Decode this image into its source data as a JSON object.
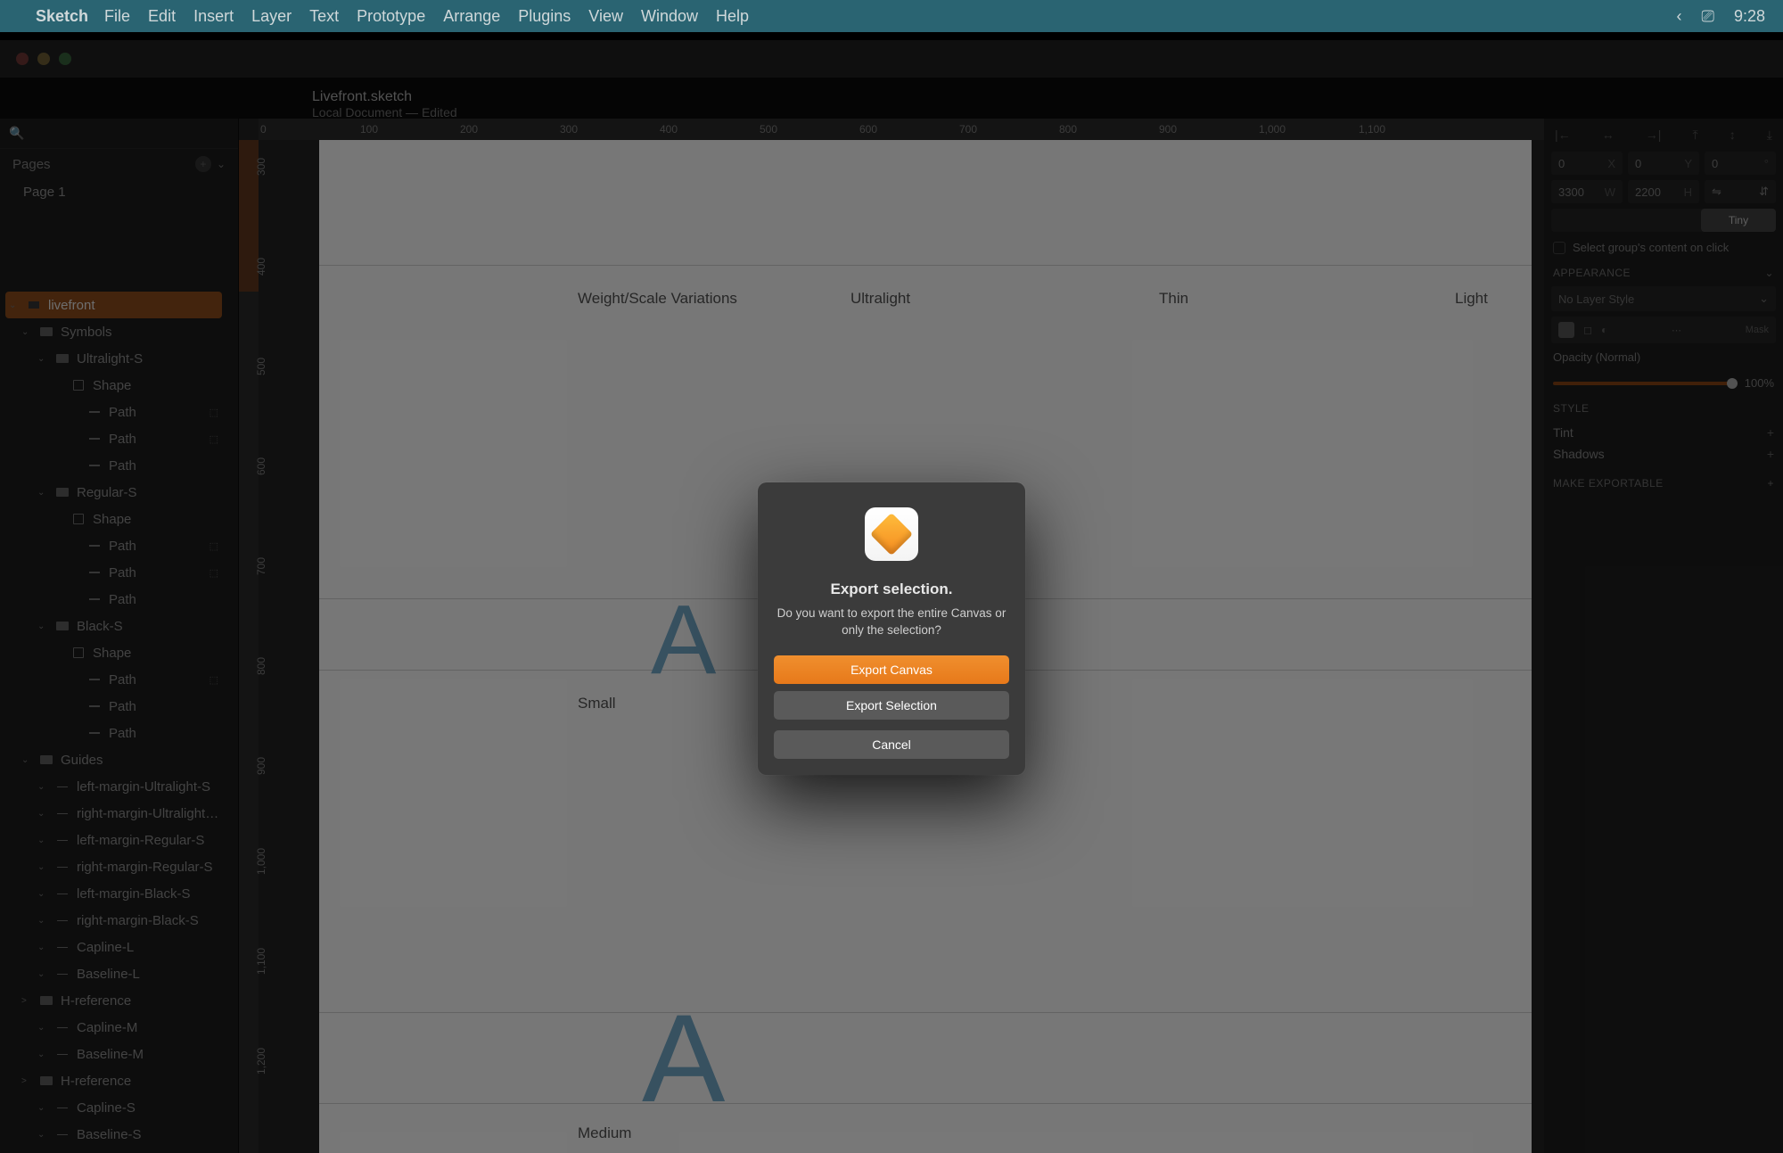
{
  "menubar": {
    "app": "Sketch",
    "items": [
      "File",
      "Edit",
      "Insert",
      "Layer",
      "Text",
      "Prototype",
      "Arrange",
      "Plugins",
      "View",
      "Window",
      "Help"
    ],
    "clock": "9:28"
  },
  "window": {
    "title": "Livefront.sketch",
    "subtitle": "Local Document — Edited"
  },
  "sidebar": {
    "search_placeholder": "",
    "pages_label": "Pages",
    "page1": "Page 1",
    "tree": [
      {
        "d": 0,
        "sel": true,
        "icon": "artboard",
        "label": "livefront"
      },
      {
        "d": 1,
        "icon": "folder",
        "label": "Symbols"
      },
      {
        "d": 2,
        "icon": "folder",
        "label": "Ultralight-S"
      },
      {
        "d": 3,
        "icon": "shape",
        "label": "Shape"
      },
      {
        "d": 4,
        "icon": "path",
        "label": "Path",
        "g": true
      },
      {
        "d": 4,
        "icon": "path",
        "label": "Path",
        "g": true
      },
      {
        "d": 4,
        "icon": "path",
        "label": "Path"
      },
      {
        "d": 2,
        "icon": "folder",
        "label": "Regular-S"
      },
      {
        "d": 3,
        "icon": "shape",
        "label": "Shape"
      },
      {
        "d": 4,
        "icon": "path",
        "label": "Path",
        "g": true
      },
      {
        "d": 4,
        "icon": "path",
        "label": "Path",
        "g": true
      },
      {
        "d": 4,
        "icon": "path",
        "label": "Path"
      },
      {
        "d": 2,
        "icon": "folder",
        "label": "Black-S"
      },
      {
        "d": 3,
        "icon": "shape",
        "label": "Shape"
      },
      {
        "d": 4,
        "icon": "path",
        "label": "Path",
        "g": true
      },
      {
        "d": 4,
        "icon": "path",
        "label": "Path"
      },
      {
        "d": 4,
        "icon": "path",
        "label": "Path"
      },
      {
        "d": 1,
        "icon": "folder",
        "label": "Guides"
      },
      {
        "d": 2,
        "icon": "line",
        "label": "left-margin-Ultralight-S"
      },
      {
        "d": 2,
        "icon": "line",
        "label": "right-margin-Ultralight…"
      },
      {
        "d": 2,
        "icon": "line",
        "label": "left-margin-Regular-S"
      },
      {
        "d": 2,
        "icon": "line",
        "label": "right-margin-Regular-S"
      },
      {
        "d": 2,
        "icon": "line",
        "label": "left-margin-Black-S"
      },
      {
        "d": 2,
        "icon": "line",
        "label": "right-margin-Black-S"
      },
      {
        "d": 2,
        "icon": "line",
        "label": "Capline-L"
      },
      {
        "d": 2,
        "icon": "line",
        "label": "Baseline-L"
      },
      {
        "d": 1,
        "icon": "folder",
        "label": "H-reference",
        "exp": ">"
      },
      {
        "d": 2,
        "icon": "line",
        "label": "Capline-M"
      },
      {
        "d": 2,
        "icon": "line",
        "label": "Baseline-M"
      },
      {
        "d": 1,
        "icon": "folder",
        "label": "H-reference",
        "exp": ">"
      },
      {
        "d": 2,
        "icon": "line",
        "label": "Capline-S"
      },
      {
        "d": 2,
        "icon": "line",
        "label": "Baseline-S"
      }
    ]
  },
  "ruler": {
    "top": [
      "0",
      "100",
      "200",
      "300",
      "400",
      "500",
      "600",
      "700",
      "800",
      "900",
      "1,000",
      "1,100"
    ],
    "left": [
      "300",
      "400",
      "500",
      "600",
      "700",
      "800",
      "900",
      "1,000",
      "1,100",
      "1,200"
    ]
  },
  "canvas": {
    "h1": "Weight/Scale Variations",
    "c1": "Ultralight",
    "c2": "Thin",
    "c3": "Light",
    "r1": "Small",
    "r2": "Medium"
  },
  "inspector": {
    "x": "0",
    "y": "0",
    "rot": "0",
    "w": "3300",
    "h": "2200",
    "resize": [
      "",
      "",
      "Tiny"
    ],
    "selectgroup": "Select group's content on click",
    "appearance": "Appearance",
    "nostyle": "No Layer Style",
    "mask": "Mask",
    "opacity_label": "Opacity (Normal)",
    "opacity_value": "100%",
    "style": "Style",
    "tint": "Tint",
    "shadows": "Shadows",
    "exportable": "Make Exportable"
  },
  "modal": {
    "title": "Export selection.",
    "desc": "Do you want to export the entire Canvas or only the selection?",
    "btn1": "Export Canvas",
    "btn2": "Export Selection",
    "btn3": "Cancel"
  }
}
